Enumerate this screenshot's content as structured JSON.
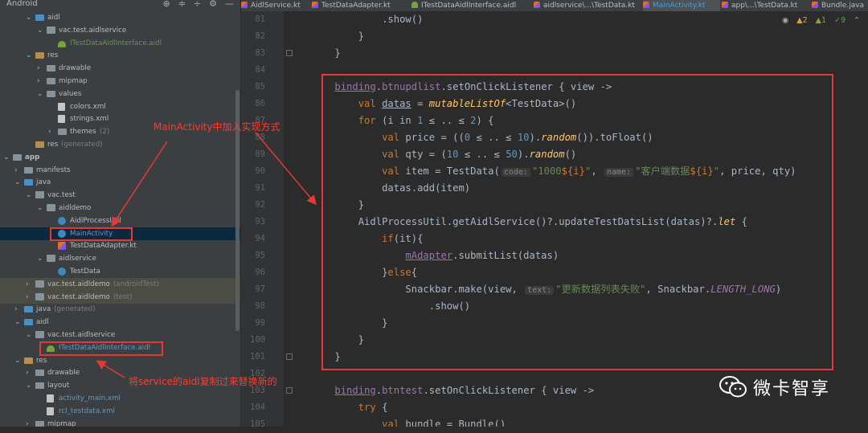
{
  "project": {
    "view_label": "Android",
    "tree": [
      {
        "label": "aidl",
        "icon": "folder-icon",
        "kind": "src",
        "open": true
      },
      {
        "label": "vac.test.aidlservice",
        "icon": "folder-icon",
        "kind": "pkg",
        "open": true
      },
      {
        "label": "ITestDataAidlInterface.aidl",
        "icon": "android-icon",
        "kind": "droid",
        "color": "green"
      },
      {
        "label": "res",
        "icon": "folder-icon",
        "kind": "res",
        "open": true
      },
      {
        "label": "drawable",
        "icon": "folder-icon",
        "kind": "folder",
        "open": false
      },
      {
        "label": "mipmap",
        "icon": "folder-icon",
        "kind": "folder",
        "open": false
      },
      {
        "label": "values",
        "icon": "folder-icon",
        "kind": "folder",
        "open": true
      },
      {
        "label": "colors.xml",
        "icon": "xml-file-icon",
        "kind": "file"
      },
      {
        "label": "strings.xml",
        "icon": "xml-file-icon",
        "kind": "file"
      },
      {
        "label": "themes",
        "sub": "(2)",
        "icon": "folder-icon",
        "kind": "folder",
        "open": false
      },
      {
        "label": "res",
        "sub": "(generated)",
        "icon": "folder-icon",
        "kind": "res"
      },
      {
        "label": "app",
        "icon": "module-icon",
        "kind": "folder",
        "open": true,
        "bold": true
      },
      {
        "label": "manifests",
        "icon": "folder-icon",
        "kind": "folder",
        "open": false
      },
      {
        "label": "java",
        "icon": "folder-icon",
        "kind": "src",
        "open": true
      },
      {
        "label": "vac.test",
        "icon": "folder-icon",
        "kind": "pkg",
        "open": true
      },
      {
        "label": "aidldemo",
        "icon": "folder-icon",
        "kind": "pkg",
        "open": true
      },
      {
        "label": "AidlProcessUtil",
        "icon": "kotlin-object-icon",
        "kind": "cls",
        "color": "orange"
      },
      {
        "label": "MainActivity",
        "icon": "kotlin-class-icon",
        "kind": "cls",
        "selected": true,
        "color": "blue"
      },
      {
        "label": "TestDataAdapter.kt",
        "icon": "kotlin-file-icon",
        "kind": "kt"
      },
      {
        "label": "aidlservice",
        "icon": "folder-icon",
        "kind": "pkg",
        "open": true
      },
      {
        "label": "TestData",
        "icon": "kotlin-class-icon",
        "kind": "cls"
      },
      {
        "label": "vac.test.aidldemo",
        "sub": "(androidTest)",
        "icon": "folder-icon",
        "kind": "pkg",
        "open": false,
        "highlight": true
      },
      {
        "label": "vac.test.aidldemo",
        "sub": "(test)",
        "icon": "folder-icon",
        "kind": "pkg",
        "open": false,
        "highlight": true
      },
      {
        "label": "java",
        "sub": "(generated)",
        "icon": "folder-icon",
        "kind": "src",
        "open": false
      },
      {
        "label": "aidl",
        "icon": "folder-icon",
        "kind": "src",
        "open": true
      },
      {
        "label": "vac.test.aidlservice",
        "icon": "folder-icon",
        "kind": "pkg",
        "open": true
      },
      {
        "label": "ITestDataAidlInterface.aidl",
        "icon": "android-icon",
        "kind": "droid",
        "color": "blue"
      },
      {
        "label": "res",
        "icon": "folder-icon",
        "kind": "res",
        "open": true
      },
      {
        "label": "drawable",
        "icon": "folder-icon",
        "kind": "folder",
        "open": false
      },
      {
        "label": "layout",
        "icon": "folder-icon",
        "kind": "folder",
        "open": true
      },
      {
        "label": "activity_main.xml",
        "icon": "xml-file-icon",
        "kind": "file",
        "color": "blue"
      },
      {
        "label": "rcl_testdata.xml",
        "icon": "xml-file-icon",
        "kind": "file",
        "color": "blue"
      },
      {
        "label": "mipmap",
        "icon": "folder-icon",
        "kind": "folder",
        "open": false
      }
    ]
  },
  "tabs": [
    {
      "label": "AidlService.kt",
      "icon": "kotlin-file-icon"
    },
    {
      "label": "TestDataAdapter.kt",
      "icon": "kotlin-file-icon"
    },
    {
      "label": "ITestDataAidlInterface.aidl",
      "icon": "android-icon"
    },
    {
      "label": "aidlservice\\...\\TestData.kt",
      "icon": "kotlin-file-icon"
    },
    {
      "label": "MainActivity.kt",
      "icon": "kotlin-file-icon",
      "active": true
    },
    {
      "label": "app\\...\\TestData.kt",
      "icon": "kotlin-file-icon"
    },
    {
      "label": "Bundle.java",
      "icon": "java-file-icon"
    }
  ],
  "inspection": {
    "warnings": "2",
    "weak": "1",
    "ok": "9"
  },
  "line_numbers": [
    "81",
    "82",
    "83",
    "84",
    "85",
    "86",
    "87",
    "88",
    "89",
    "90",
    "91",
    "92",
    "93",
    "94",
    "95",
    "96",
    "97",
    "98",
    "99",
    "100",
    "101",
    "102",
    "103",
    "104",
    "105"
  ],
  "code_tokens": {
    "l81_show": ".show()",
    "binding": "binding",
    "btnupdlist": "btnupdlist",
    "setOnClickListener": ".setOnClickListener { ",
    "view_arrow": "view ->",
    "val": "val ",
    "datas": "datas",
    "eq_mutable": " = ",
    "mutableListOf": "mutableListOf",
    "testdata_generic": "<TestData>()",
    "for": "for ",
    "for_range": "(i in ",
    "n1": "1",
    "range_op": " ≤ .. ≤ ",
    "n2": "2",
    "for_close": ") {",
    "price_line": "price = ((",
    "n0": "0",
    "n10": "10",
    "random": "random",
    "tofloat": "()).toFloat()",
    "qty_line": "qty = (",
    "n10b": "10",
    "n50": "50",
    "item_line": "item = TestData(",
    "hint_code": "code:",
    "str_code_a": "\"1000",
    "str_code_b": "${i}",
    "str_code_c": "\"",
    "hint_name": "name:",
    "str_name_a": "\"客户端数据",
    "str_name_b": "${i}",
    "str_name_c": "\"",
    "item_tail": ", price, qty)",
    "add_line": "datas.add(item)",
    "close_brace": "}",
    "aidl_line": "AidlProcessUtil.getAidlService()?.updateTestDatsList(datas)?.",
    "let": "let",
    "let_open": " {",
    "if_kw": "if",
    "if_cond": "(it){",
    "madapter": "mAdapter",
    "submit": ".submitList(datas)",
    "else_close": "}",
    "else_kw": "else",
    "else_open": "{",
    "snack_a": "Snackbar.make(view, ",
    "hint_text": "text:",
    "snack_str": "\"更新数据列表失败\"",
    "snack_b": ", Snackbar.",
    "length_long": "LENGTH_LONG",
    "snack_c": ")",
    "show2": ".show()",
    "btntest": "btntest",
    "try_kw": "try",
    "try_open": " {",
    "bundle_line": "bundle = Bundle()"
  },
  "annotations": {
    "main_activity_note": "MainActivity中加入实现方式",
    "aidl_note": "将service的aidl复制过来替换新的",
    "accent_red": "#e53935"
  },
  "watermark": {
    "text": "微卡智享"
  }
}
